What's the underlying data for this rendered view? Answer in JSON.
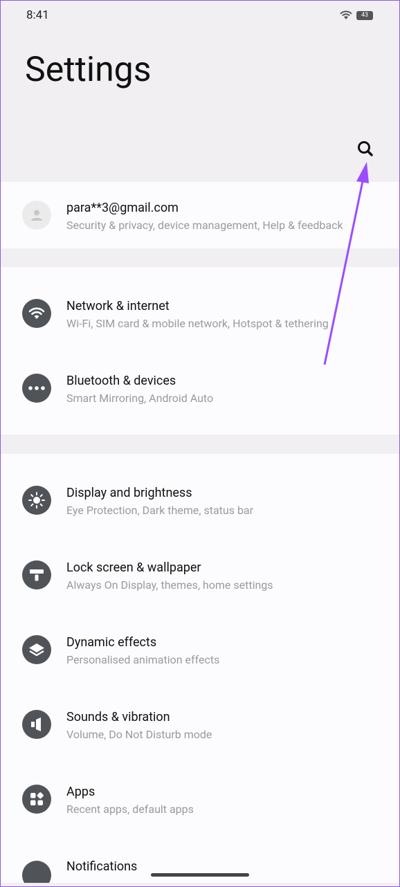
{
  "status": {
    "time": "8:41",
    "battery": "43"
  },
  "header": {
    "title": "Settings"
  },
  "account": {
    "email": "para**3@gmail.com",
    "subtitle": "Security & privacy, device management, Help & feedback"
  },
  "items": [
    {
      "title": "Network & internet",
      "subtitle": "Wi-Fi, SIM card & mobile network, Hotspot & tethering",
      "icon": "wifi-icon"
    },
    {
      "title": "Bluetooth & devices",
      "subtitle": "Smart Mirroring, Android Auto",
      "icon": "more-dots-icon"
    },
    {
      "title": "Display and brightness",
      "subtitle": "Eye Protection, Dark theme, status bar",
      "icon": "brightness-icon"
    },
    {
      "title": "Lock screen & wallpaper",
      "subtitle": "Always On Display, themes, home settings",
      "icon": "wallpaper-icon"
    },
    {
      "title": "Dynamic effects",
      "subtitle": "Personalised animation effects",
      "icon": "layers-icon"
    },
    {
      "title": "Sounds & vibration",
      "subtitle": "Volume, Do Not Disturb mode",
      "icon": "speaker-icon"
    },
    {
      "title": "Apps",
      "subtitle": "Recent apps, default apps",
      "icon": "apps-icon"
    },
    {
      "title": "Notifications",
      "subtitle": "",
      "icon": "notifications-icon"
    }
  ],
  "colors": {
    "accent_arrow": "#9b4dff",
    "icon_bg": "#505459",
    "header_bg": "#f1eff2",
    "card_bg": "#fcfbfd"
  }
}
